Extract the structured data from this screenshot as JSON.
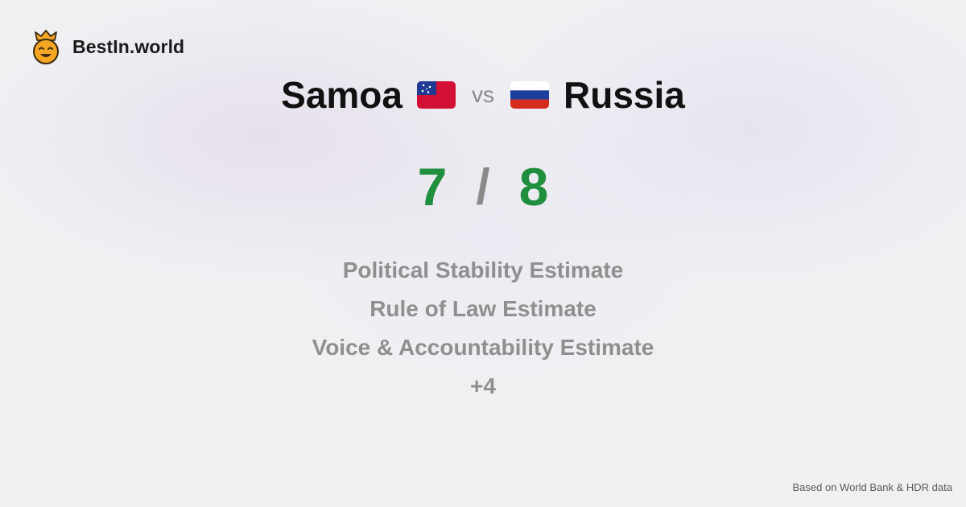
{
  "brand": {
    "name": "BestIn.world",
    "logo_icon": "crowned-smiley-icon"
  },
  "comparison": {
    "left": {
      "name": "Samoa",
      "flag_icon": "samoa-flag-icon",
      "score": "7"
    },
    "vs_label": "vs",
    "right": {
      "name": "Russia",
      "flag_icon": "russia-flag-icon",
      "score": "8"
    },
    "score_separator": "/"
  },
  "metrics": [
    "Political Stability Estimate",
    "Rule of Law Estimate",
    "Voice & Accountability Estimate"
  ],
  "more_label": "+4",
  "footer": {
    "source": "Based on World Bank & HDR data"
  },
  "colors": {
    "score": "#1f8f3e",
    "muted": "#8f8f8f",
    "title": "#111111",
    "logo": "#f5a623"
  }
}
